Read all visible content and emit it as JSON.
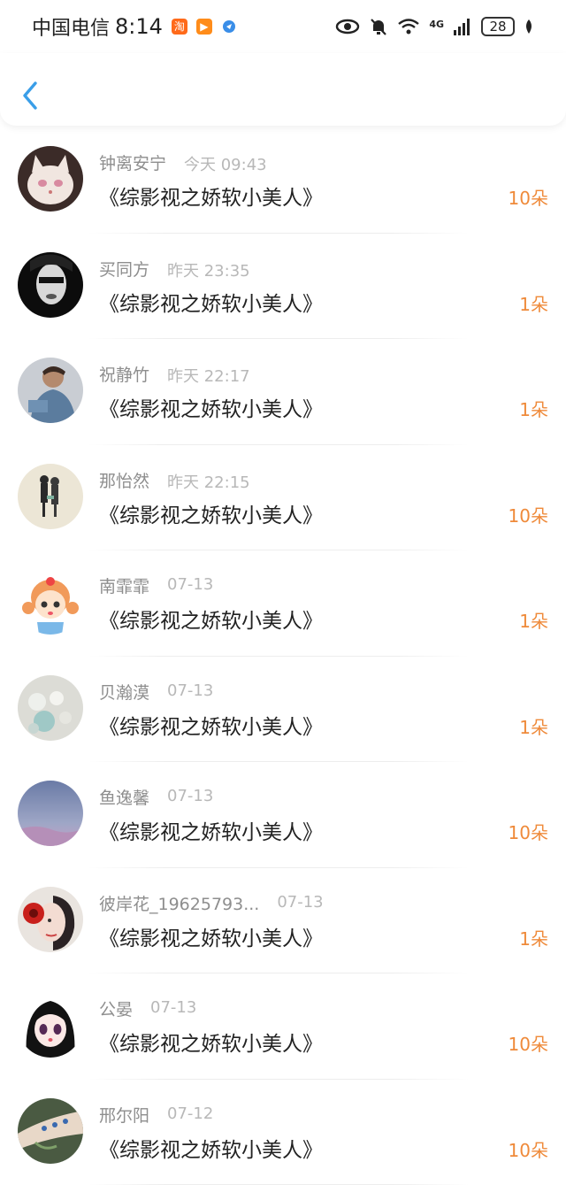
{
  "status_bar": {
    "carrier": "中国电信",
    "time": "8:14",
    "network": "4G",
    "battery": "28"
  },
  "colors": {
    "accent": "#3a9ee8",
    "amount": "#ef8a3a",
    "name": "#8e8e8e",
    "time": "#b8b8b8"
  },
  "records": [
    {
      "name": "钟离安宁",
      "time": "今天 09:43",
      "book": "《综影视之娇软小美人》",
      "amount": "10朵",
      "avatar": "cat-avatar"
    },
    {
      "name": "买同方",
      "time": "昨天 23:35",
      "book": "《综影视之娇软小美人》",
      "amount": "1朵",
      "avatar": "masked-face-avatar"
    },
    {
      "name": "祝静竹",
      "time": "昨天 22:17",
      "book": "《综影视之娇软小美人》",
      "amount": "1朵",
      "avatar": "boy-photo-avatar"
    },
    {
      "name": "那怡然",
      "time": "昨天 22:15",
      "book": "《综影视之娇软小美人》",
      "amount": "10朵",
      "avatar": "figures-avatar"
    },
    {
      "name": "南霏霏",
      "time": "07-13",
      "book": "《综影视之娇软小美人》",
      "amount": "1朵",
      "avatar": "cartoon-girl-avatar"
    },
    {
      "name": "贝瀚漠",
      "time": "07-13",
      "book": "《综影视之娇软小美人》",
      "amount": "1朵",
      "avatar": "pearls-avatar"
    },
    {
      "name": "鱼逸馨",
      "time": "07-13",
      "book": "《综影视之娇软小美人》",
      "amount": "10朵",
      "avatar": "sky-avatar"
    },
    {
      "name": "彼岸花_19625793...",
      "time": "07-13",
      "book": "《综影视之娇软小美人》",
      "amount": "1朵",
      "avatar": "flower-girl-avatar"
    },
    {
      "name": "公晏",
      "time": "07-13",
      "book": "《综影视之娇软小美人》",
      "amount": "10朵",
      "avatar": "anime-girl-avatar"
    },
    {
      "name": "邢尔阳",
      "time": "07-12",
      "book": "《综影视之娇软小美人》",
      "amount": "10朵",
      "avatar": "tattoo-arm-avatar"
    }
  ]
}
